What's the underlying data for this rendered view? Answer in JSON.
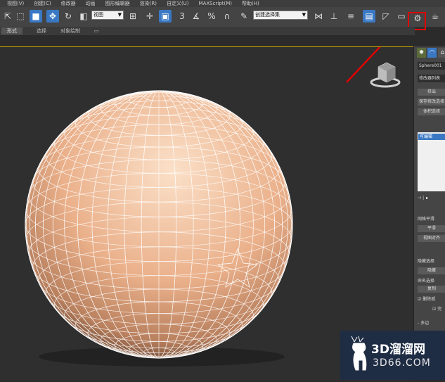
{
  "menu": [
    "视图(V)",
    "创建(C)",
    "修改器",
    "动画",
    "图形编辑器",
    "渲染(R)",
    "自定义(U)",
    "MAXScript(M)",
    "帮助(H)"
  ],
  "toolbar": {
    "view_dropdown": "视图",
    "selection_set_dropdown": "创建选择集",
    "number_3": "3",
    "percent_label": "%"
  },
  "ribbon": {
    "tab1": "形式",
    "tab2": "选择",
    "tab3": "对象绘制"
  },
  "panel": {
    "object_name": "Sphere001",
    "modifier_list": "修改器列表",
    "btn_extrude": "挤出",
    "btn_soft": "保存修改选择",
    "btn_volume": "体积选择",
    "stack_item": "可编辑",
    "row_grid": "网格平滑",
    "btn_smooth": "平滑",
    "btn_view": "视图对齐",
    "row_hide": "隐藏选择",
    "btn_hide": "隐藏",
    "row_named": "命名选择",
    "btn_copy": "复制",
    "cb_delete": "删除孤",
    "cb_full": "完",
    "row_multi": "多边"
  },
  "colors": {
    "accent": "#3a78c4",
    "highlight": "#e00000",
    "sphere": "#f0c09a"
  },
  "watermark": {
    "title": "3D溜溜网",
    "domain": "3D66.COM"
  }
}
